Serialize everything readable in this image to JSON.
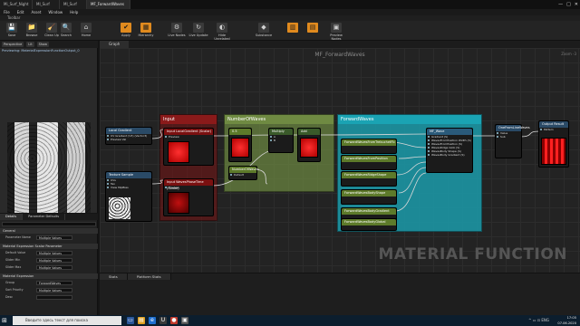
{
  "window": {
    "tabs": [
      "Mi_Surf_Night",
      "MI_Surf",
      "MI_Surf",
      "MF_ForwardWaves"
    ],
    "controls": [
      "—",
      "□",
      "✕"
    ]
  },
  "menu": [
    "File",
    "Edit",
    "Asset",
    "Window",
    "Help"
  ],
  "toolbar": {
    "label": "Toolbar",
    "buttons": [
      {
        "label": "Save",
        "icon": "save-icon",
        "glyph": "💾"
      },
      {
        "label": "Browse",
        "icon": "folder-icon",
        "glyph": "📁"
      },
      {
        "label": "Clean Up",
        "icon": "broom-icon",
        "glyph": "🧹"
      },
      {
        "label": "Apply",
        "icon": "apply-icon",
        "glyph": "✔",
        "highlight": true
      },
      {
        "label": "Search",
        "icon": "search-icon",
        "glyph": "🔍"
      },
      {
        "label": "Home",
        "icon": "home-icon",
        "glyph": "⌂"
      },
      {
        "label": "Hierarchy",
        "icon": "hierarchy-icon",
        "glyph": "▦",
        "highlight": true
      },
      {
        "label": "Live Nodes",
        "icon": "live-nodes-icon",
        "glyph": "⚙"
      },
      {
        "label": "Live Update",
        "icon": "live-update-icon",
        "glyph": "↻"
      },
      {
        "label": "Hide Unrelated",
        "icon": "hide-unrelated-icon",
        "glyph": "◐"
      },
      {
        "label": "Substance",
        "icon": "substance-icon",
        "glyph": "◆"
      },
      {
        "label": "",
        "icon": "stats-icon",
        "glyph": "▥",
        "highlight": true
      },
      {
        "label": "",
        "icon": "platform-stats-icon",
        "glyph": "▤",
        "highlight": true
      },
      {
        "label": "Preview Nodes",
        "icon": "preview-nodes-icon",
        "glyph": "▣"
      }
    ]
  },
  "viewport": {
    "buttons": [
      "Perspective",
      "Lit",
      "Show"
    ],
    "info": "Previewing: MaterialExpressionFunctionOutput_0"
  },
  "details": {
    "tabs": [
      "Details",
      "Parameter Defaults"
    ],
    "sections": [
      {
        "title": "General",
        "props": [
          {
            "label": "Parameter Name",
            "value": "Multiple Values"
          }
        ]
      },
      {
        "title": "Material Expression Scalar Parameter",
        "props": [
          {
            "label": "Default Value",
            "value": "Multiple Values"
          },
          {
            "label": "Slider Min",
            "value": "Multiple Values"
          },
          {
            "label": "Slider Max",
            "value": "Multiple Values"
          }
        ]
      },
      {
        "title": "Material Expression",
        "props": [
          {
            "label": "Group",
            "value": "ForwardWaves"
          },
          {
            "label": "Sort Priority",
            "value": "Multiple Values"
          },
          {
            "label": "Desc",
            "value": ""
          }
        ]
      }
    ]
  },
  "graph": {
    "tab": "Graph",
    "title": "MF_ForwardWaves",
    "zoom": "Zoom -3",
    "watermark": "MATERIAL FUNCTION",
    "comments": [
      {
        "title": "Input",
        "color": "#8a1a1a"
      },
      {
        "title": "NumberOfWaves",
        "color": "#6f8a42"
      },
      {
        "title": "ForwardWaves",
        "color": "#1aa3b3"
      }
    ],
    "nodes": [
      {
        "title": "Local Gradient",
        "pins": [
          "UV Gradient (V3) (Vector3)",
          "Preview Val"
        ]
      },
      {
        "title": "Texture Sample",
        "pins": [
          "UVs",
          "Tex",
          "View MipBias",
          "Apply View MipBias"
        ]
      },
      {
        "title": "Input LocalGradient (Scalar)",
        "pins": [
          "Preview"
        ]
      },
      {
        "title": "Input WavesPhaseTime (Scalar)",
        "pins": [
          "Preview"
        ]
      },
      {
        "title": "0.5",
        "pins": []
      },
      {
        "title": "NumberOfWaves",
        "pins": [
          "Default"
        ]
      },
      {
        "title": "Multiply",
        "pins": [
          "A",
          "B"
        ]
      },
      {
        "title": "Add",
        "pins": [
          "A",
          "B"
        ]
      },
      {
        "title": "MF_Wave",
        "pins": [
          "Gradient (S)",
          "WavesFromPosition Width (S)",
          "WavesFromPosition (S)",
          "WavesRidge Glob (S)",
          "WavesBody Shape (S)",
          "WavesBody Gradient (S)"
        ]
      },
      {
        "title": "ForwardWavesFromTrebuchetFb",
        "pins": []
      },
      {
        "title": "ForwardWavesFromPosition",
        "pins": []
      },
      {
        "title": "ForwardWavesRidgeShape",
        "pins": []
      },
      {
        "title": "ForwardWavesBodyShape",
        "pins": []
      },
      {
        "title": "ForwardWavesBodyGradient",
        "pins": []
      },
      {
        "title": "ForwardWavesBodyGlobal",
        "pins": []
      },
      {
        "title": "OneFromLineWaves",
        "pins": [
          "Value",
          "Sub"
        ]
      },
      {
        "title": "Output Result",
        "pins": [
          "Pattern"
        ]
      }
    ]
  },
  "bottom": {
    "tabs": [
      "Stats",
      "Platform Stats"
    ]
  },
  "taskbar": {
    "search_placeholder": "Введите здесь текст для поиска",
    "tray": "^ ▭ ⊡ ENG",
    "time": "17:05",
    "date": "07.06.2020"
  }
}
